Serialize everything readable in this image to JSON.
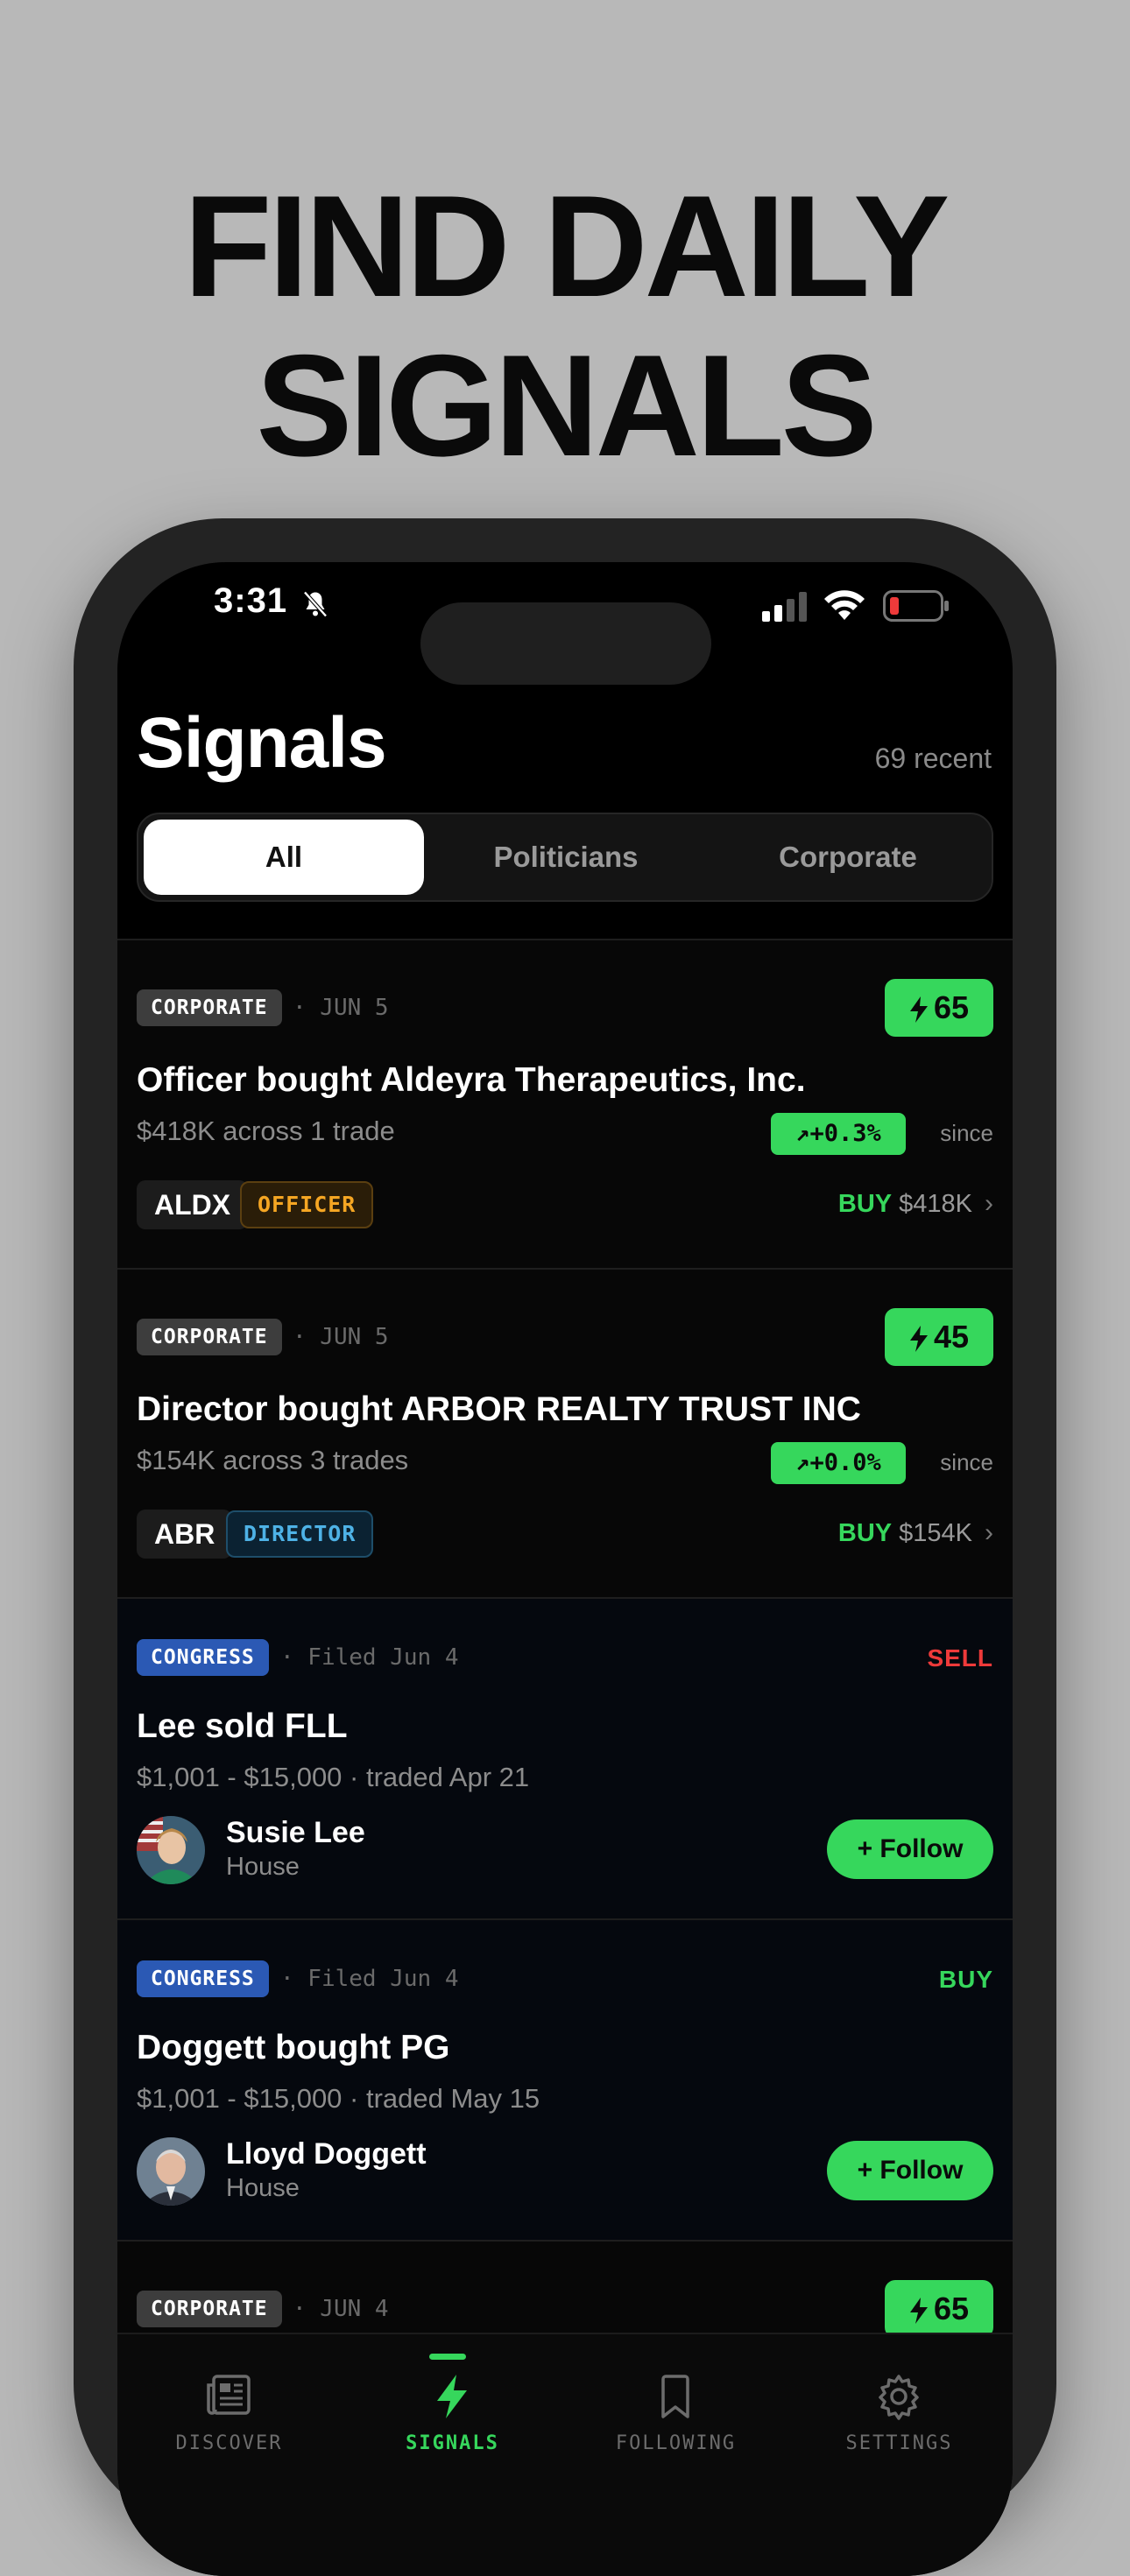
{
  "headline": {
    "line1": "FIND DAILY",
    "line2": "SIGNALS"
  },
  "status_bar": {
    "time": "3:31"
  },
  "header": {
    "title": "Signals",
    "recent_count": "69 recent"
  },
  "filter_tabs": [
    {
      "label": "All",
      "active": true
    },
    {
      "label": "Politicians",
      "active": false
    },
    {
      "label": "Corporate",
      "active": false
    }
  ],
  "cards": [
    {
      "kind": "corporate",
      "badge": "CORPORATE",
      "date": "· JUN 5",
      "score": "65",
      "title": "Officer bought Aldeyra Therapeutics, Inc.",
      "subtitle": "$418K across 1 trade",
      "performance": "+0.3%",
      "since": "since",
      "ticker": "ALDX",
      "role": "OFFICER",
      "side": "BUY",
      "amount": "$418K"
    },
    {
      "kind": "corporate",
      "badge": "CORPORATE",
      "date": "· JUN 5",
      "score": "45",
      "title": "Director bought ARBOR REALTY TRUST INC",
      "subtitle": "$154K across 3 trades",
      "performance": "+0.0%",
      "since": "since",
      "ticker": "ABR",
      "role": "DIRECTOR",
      "side": "BUY",
      "amount": "$154K"
    },
    {
      "kind": "congress",
      "badge": "CONGRESS",
      "date": "· Filed Jun 4",
      "action": "SELL",
      "title": "Lee sold FLL",
      "subtitle": "$1,001 - $15,000 · traded Apr 21",
      "person": "Susie Lee",
      "chamber": "House",
      "follow_label": "+ Follow"
    },
    {
      "kind": "congress",
      "badge": "CONGRESS",
      "date": "· Filed Jun 4",
      "action": "BUY",
      "title": "Doggett bought PG",
      "subtitle": "$1,001 - $15,000 · traded May 15",
      "person": "Lloyd Doggett",
      "chamber": "House",
      "follow_label": "+ Follow"
    },
    {
      "kind": "corporate",
      "badge": "CORPORATE",
      "date": "· JUN 4",
      "score": "65"
    }
  ],
  "tab_bar": [
    {
      "label": "DISCOVER",
      "icon": "newspaper-icon",
      "active": false
    },
    {
      "label": "SIGNALS",
      "icon": "bolt-icon",
      "active": true
    },
    {
      "label": "FOLLOWING",
      "icon": "bookmark-icon",
      "active": false
    },
    {
      "label": "SETTINGS",
      "icon": "gear-icon",
      "active": false
    }
  ],
  "colors": {
    "accent_green": "#36d75c",
    "sell_red": "#ee3a3a",
    "congress_blue": "#2b59b4",
    "officer_orange": "#f5a623",
    "director_blue": "#4eb2e6",
    "background": "#000000"
  }
}
